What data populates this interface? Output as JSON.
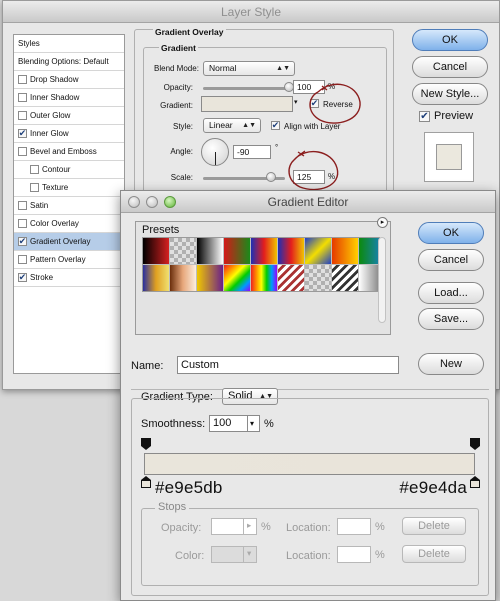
{
  "layer_style": {
    "title": "Layer Style",
    "styles_header": "Styles",
    "blending_options": "Blending Options: Default",
    "effects": [
      {
        "label": "Drop Shadow",
        "checked": false,
        "indent": false,
        "selected": false
      },
      {
        "label": "Inner Shadow",
        "checked": false,
        "indent": false,
        "selected": false
      },
      {
        "label": "Outer Glow",
        "checked": false,
        "indent": false,
        "selected": false
      },
      {
        "label": "Inner Glow",
        "checked": true,
        "indent": false,
        "selected": false
      },
      {
        "label": "Bevel and Emboss",
        "checked": false,
        "indent": false,
        "selected": false
      },
      {
        "label": "Contour",
        "checked": false,
        "indent": true,
        "selected": false
      },
      {
        "label": "Texture",
        "checked": false,
        "indent": true,
        "selected": false
      },
      {
        "label": "Satin",
        "checked": false,
        "indent": false,
        "selected": false
      },
      {
        "label": "Color Overlay",
        "checked": false,
        "indent": false,
        "selected": false
      },
      {
        "label": "Gradient Overlay",
        "checked": true,
        "indent": false,
        "selected": true
      },
      {
        "label": "Pattern Overlay",
        "checked": false,
        "indent": false,
        "selected": false
      },
      {
        "label": "Stroke",
        "checked": true,
        "indent": false,
        "selected": false
      }
    ],
    "section_title": "Gradient Overlay",
    "subsection_title": "Gradient",
    "blend_mode_label": "Blend Mode:",
    "blend_mode_value": "Normal",
    "opacity_label": "Opacity:",
    "opacity_value": "100",
    "percent": "%",
    "gradient_label": "Gradient:",
    "reverse_label": "Reverse",
    "reverse_checked": true,
    "style_label": "Style:",
    "style_value": "Linear",
    "align_label": "Align with Layer",
    "align_checked": true,
    "angle_label": "Angle:",
    "angle_value": "-90",
    "degree": "°",
    "scale_label": "Scale:",
    "scale_value": "125",
    "buttons": {
      "ok": "OK",
      "cancel": "Cancel",
      "new_style": "New Style..."
    },
    "preview_label": "Preview",
    "preview_checked": true
  },
  "gradient_editor": {
    "title": "Gradient Editor",
    "presets_label": "Presets",
    "buttons": {
      "ok": "OK",
      "cancel": "Cancel",
      "load": "Load...",
      "save": "Save...",
      "new": "New"
    },
    "name_label": "Name:",
    "name_value": "Custom",
    "gradient_type_label": "Gradient Type:",
    "gradient_type_value": "Solid",
    "smoothness_label": "Smoothness:",
    "smoothness_value": "100",
    "percent": "%",
    "left_color_hex": "#e9e5db",
    "right_color_hex": "#e9e4da",
    "stops_label": "Stops",
    "opacity_label": "Opacity:",
    "color_label": "Color:",
    "location_label": "Location:",
    "delete_label": "Delete",
    "presets": [
      "linear-gradient(90deg,#000,#6a1010,#d62020)",
      "repeating-conic-gradient(#e0e0e0 0 25%,#b0b0b0 0 50%) 0 0/8px 8px",
      "linear-gradient(90deg,#000,#fff)",
      "linear-gradient(90deg,#d41818,#1a8a1a)",
      "linear-gradient(90deg,#1d2fb5,#e31d1d,#f0c300)",
      "linear-gradient(90deg,#1d2fb5,#e31d1d,#f0c300)",
      "linear-gradient(135deg,#1e3fc9,#f3de00,#1e3fc9)",
      "linear-gradient(90deg,#e63a00,#ffd000)",
      "linear-gradient(90deg,#0c8a0c,#1a7fd6)",
      "linear-gradient(90deg,#2a2f9f,#e0a020,#f0e070)",
      "linear-gradient(90deg,#6b2e0c,#e8a87c,#fbeedf)",
      "linear-gradient(90deg,#f0c800,#6a1f8a)",
      "linear-gradient(135deg,#e22,#ff8c00,#ff0,#0c0,#09f,#90f)",
      "linear-gradient(90deg,#e22,#ff8c00,#ff0,#0c0,#09f,#90f)",
      "repeating-linear-gradient(135deg,#fff 0 3px,#a33 3px 6px)",
      "repeating-conic-gradient(#e0e0e0 0 25%,#b0b0b0 0 50%) 0 0/8px 8px",
      "repeating-linear-gradient(135deg,#fff 0 3px,#333 3px 6px)",
      "linear-gradient(90deg,#fff,#666)"
    ]
  }
}
